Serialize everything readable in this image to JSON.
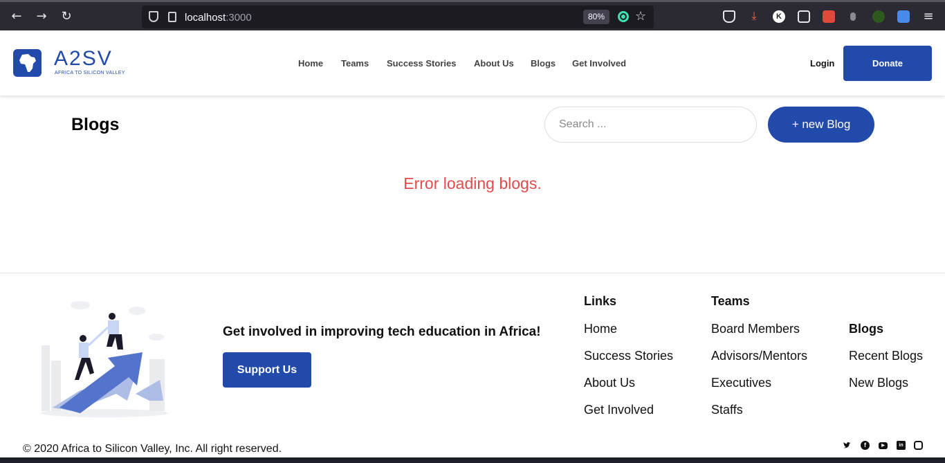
{
  "browser": {
    "url_host": "localhost",
    "url_port": ":3000",
    "zoom": "80%"
  },
  "header": {
    "logo_text": "A2SV",
    "logo_subtitle": "AFRICA TO SILICON VALLEY",
    "nav": [
      "Home",
      "Teams",
      "Success Stories",
      "About Us",
      "Blogs",
      "Get Involved"
    ],
    "login": "Login",
    "donate": "Donate"
  },
  "blogs": {
    "title": "Blogs",
    "search_placeholder": "Search ...",
    "new_blog": "+ new Blog",
    "error": "Error loading blogs."
  },
  "footer": {
    "cta_text": "Get involved in improving tech education in Africa!",
    "support_button": "Support Us",
    "links_heading": "Links",
    "links": [
      "Home",
      "Success Stories",
      "About Us",
      "Get Involved"
    ],
    "teams_heading": "Teams",
    "teams": [
      "Board Members",
      "Advisors/Mentors",
      "Executives",
      "Staffs"
    ],
    "blogs_heading": "Blogs",
    "blogs": [
      "Recent Blogs",
      "New Blogs"
    ],
    "copyright": "© 2020 Africa to Silicon Valley, Inc. All right reserved.",
    "social_icons": [
      "twitter-icon",
      "facebook-icon",
      "youtube-icon",
      "linkedin-icon",
      "instagram-icon"
    ]
  },
  "colors": {
    "brand": "#224aaa",
    "error": "#e24b4b"
  }
}
